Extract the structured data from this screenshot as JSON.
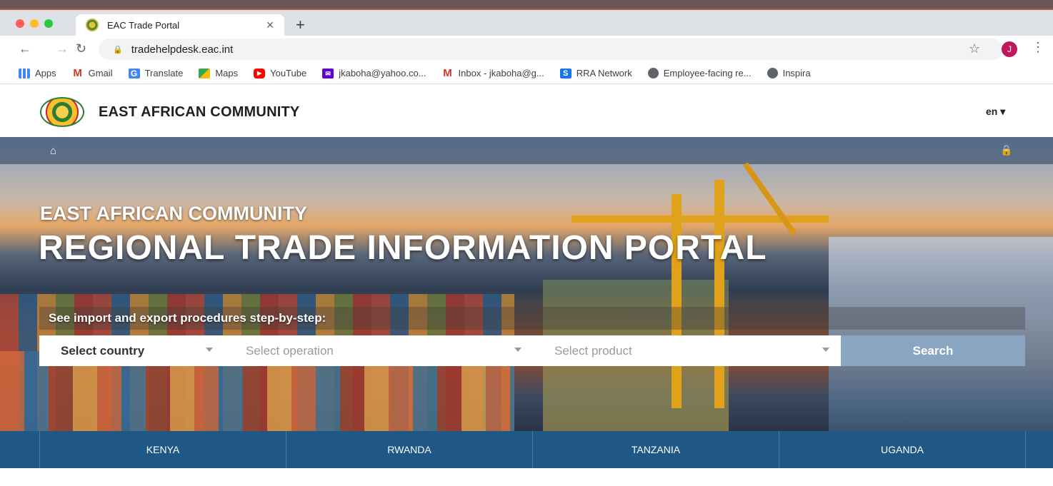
{
  "browser": {
    "tab_title": "EAC Trade Portal",
    "tab_close": "×",
    "new_tab": "+",
    "url": "tradehelpdesk.eac.int",
    "avatar_initial": "J",
    "bookmarks": [
      {
        "label": "Apps",
        "icon": "apps-icon"
      },
      {
        "label": "Gmail",
        "icon": "gmail-icon"
      },
      {
        "label": "Translate",
        "icon": "translate-icon"
      },
      {
        "label": "Maps",
        "icon": "maps-icon"
      },
      {
        "label": "YouTube",
        "icon": "youtube-icon"
      },
      {
        "label": "jkaboha@yahoo.co...",
        "icon": "yahoo-mail-icon"
      },
      {
        "label": "Inbox - jkaboha@g...",
        "icon": "gmail-icon"
      },
      {
        "label": "RRA Network",
        "icon": "rra-icon"
      },
      {
        "label": "Employee-facing re...",
        "icon": "globe-icon"
      },
      {
        "label": "Inspira",
        "icon": "globe-icon"
      }
    ]
  },
  "site": {
    "name": "EAST AFRICAN COMMUNITY",
    "language": "en ▾"
  },
  "hero": {
    "subtitle": "EAST AFRICAN COMMUNITY",
    "title": "REGIONAL TRADE INFORMATION PORTAL",
    "procedures_label": "See import and export procedures step-by-step:",
    "country_placeholder": "Select country",
    "operation_placeholder": "Select operation",
    "product_placeholder": "Select product",
    "search_label": "Search"
  },
  "countries": [
    "KENYA",
    "RWANDA",
    "TANZANIA",
    "UGANDA"
  ],
  "colors": {
    "country_bar": "#1f5785",
    "search_button": "#8aa5c1"
  }
}
